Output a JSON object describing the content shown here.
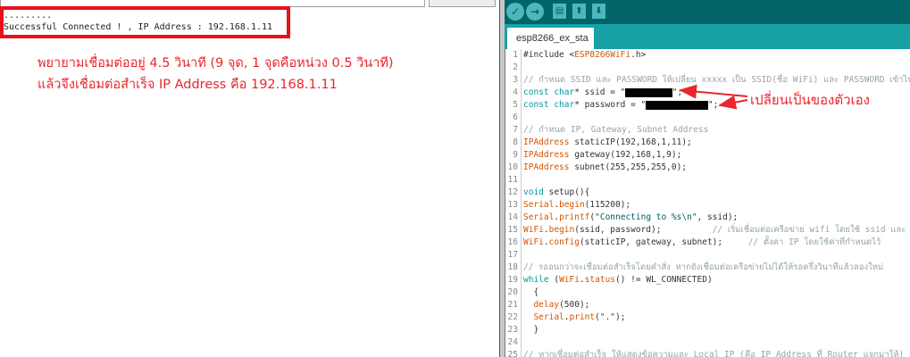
{
  "serial": {
    "output_lines": [
      ".........",
      "Successful Connected ! , IP Address : 192.168.1.11"
    ]
  },
  "notes": [
    "พยายามเชื่อมต่ออยู่ 4.5 วินาที (9 จุด, 1 จุดคือหน่วง 0.5 วินาที)",
    "แล้วจึงเชื่อมต่อสำเร็จ IP Address คือ 192.168.1.11"
  ],
  "toolbar": {
    "verify_icon": "✓",
    "upload_icon": "→",
    "new_icon": "new-file",
    "open_icon": "open",
    "save_icon": "save"
  },
  "tab": {
    "label": "esp8266_ex_sta"
  },
  "annotation": "เปลี่ยนเป็นของตัวเอง",
  "code": [
    [
      [
        "tx",
        "#include <"
      ],
      [
        "fn",
        "ESP8266WiFi"
      ],
      [
        "tx",
        ".h>"
      ]
    ],
    [],
    [
      [
        "cm",
        "// กำหนด SSID และ PASSWORD ให้เปลี่ยน xxxxx เป็น SSID(ชื่อ WiFi) และ PASSWORD เข้าไป"
      ]
    ],
    [
      [
        "kw",
        "const char"
      ],
      [
        "tx",
        "* ssid = \""
      ],
      [
        "redact",
        "9"
      ],
      [
        "tx",
        "\";"
      ]
    ],
    [
      [
        "kw",
        "const char"
      ],
      [
        "tx",
        "* password = \""
      ],
      [
        "redact",
        "12"
      ],
      [
        "tx",
        "\";"
      ]
    ],
    [],
    [
      [
        "cm",
        "// กำหนด IP, Gateway, Subnet Address"
      ]
    ],
    [
      [
        "fn",
        "IPAddress"
      ],
      [
        "tx",
        " staticIP(192,168,1,11);"
      ]
    ],
    [
      [
        "fn",
        "IPAddress"
      ],
      [
        "tx",
        " gateway(192,168,1,9);"
      ]
    ],
    [
      [
        "fn",
        "IPAddress"
      ],
      [
        "tx",
        " subnet(255,255,255,0);"
      ]
    ],
    [],
    [
      [
        "kw",
        "void"
      ],
      [
        "tx",
        " setup(){"
      ]
    ],
    [
      [
        "fn",
        "Serial"
      ],
      [
        "tx",
        "."
      ],
      [
        "fn",
        "begin"
      ],
      [
        "tx",
        "(115200);"
      ]
    ],
    [
      [
        "fn",
        "Serial"
      ],
      [
        "tx",
        "."
      ],
      [
        "fn",
        "printf"
      ],
      [
        "tx",
        "("
      ],
      [
        "st",
        "\"Connecting to %s\\n\""
      ],
      [
        "tx",
        ", ssid);"
      ]
    ],
    [
      [
        "fn",
        "WiFi"
      ],
      [
        "tx",
        "."
      ],
      [
        "fn",
        "begin"
      ],
      [
        "tx",
        "(ssid, password);          "
      ],
      [
        "cm",
        "// เริ่มเชื่อมต่อเครือข่าย wifi โดยใช้ ssid และ password"
      ]
    ],
    [
      [
        "fn",
        "WiFi"
      ],
      [
        "tx",
        "."
      ],
      [
        "fn",
        "config"
      ],
      [
        "tx",
        "(staticIP, gateway, subnet);     "
      ],
      [
        "cm",
        "// ตั้งค่า IP โดยใช้ค่าที่กำหนดไว้"
      ]
    ],
    [],
    [
      [
        "cm",
        "// รออนกว่าจะเชื่อมต่อสำเร็จโดยคำสั่ง หากยังเชื่อมต่อเครือข่ายไม่ได้ให้รอครึ่งวินาทีแล้วลองใหม่"
      ]
    ],
    [
      [
        "kw",
        "while"
      ],
      [
        "tx",
        " ("
      ],
      [
        "fn",
        "WiFi"
      ],
      [
        "tx",
        "."
      ],
      [
        "fn",
        "status"
      ],
      [
        "tx",
        "() != WL_CONNECTED)"
      ]
    ],
    [
      [
        "tx",
        "  {"
      ]
    ],
    [
      [
        "tx",
        "  "
      ],
      [
        "fn",
        "delay"
      ],
      [
        "tx",
        "(500);"
      ]
    ],
    [
      [
        "tx",
        "  "
      ],
      [
        "fn",
        "Serial"
      ],
      [
        "tx",
        "."
      ],
      [
        "fn",
        "print"
      ],
      [
        "tx",
        "("
      ],
      [
        "st",
        "\".\""
      ],
      [
        "tx",
        ");"
      ]
    ],
    [
      [
        "tx",
        "  }"
      ]
    ],
    [],
    [
      [
        "cm",
        "// หากเชื่อมต่อสำเร็จ ให้แสดงข้อความและ Local IP (คือ IP Address ที่ Router แจกมาให้)"
      ]
    ]
  ]
}
